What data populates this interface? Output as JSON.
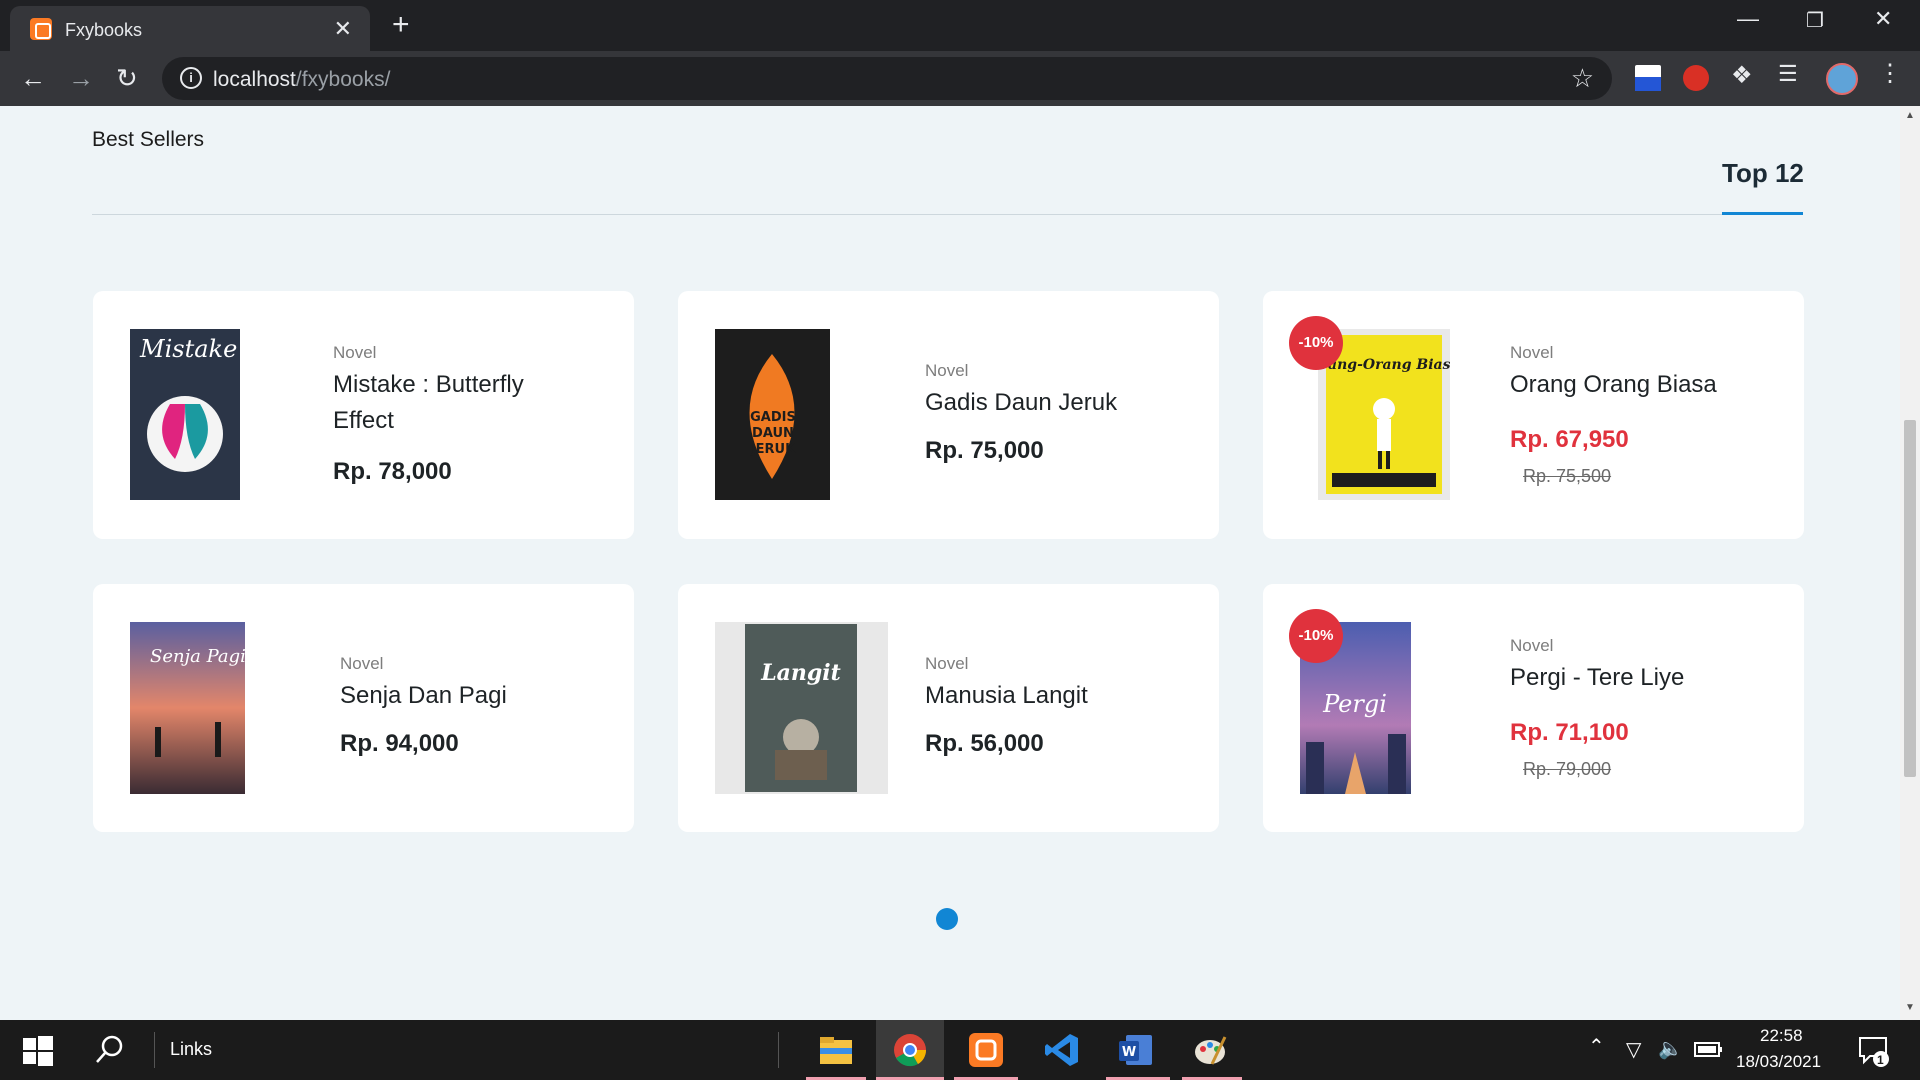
{
  "browser": {
    "tab_title": "Fxybooks",
    "tab_close": "✕",
    "new_tab": "+",
    "url_host": "localhost",
    "url_path": "/fxybooks/"
  },
  "page": {
    "section_label": "Best Sellers",
    "tab_label": "Top 12",
    "accent_color": "#1186d4",
    "sale_color": "#e0323d"
  },
  "products": [
    {
      "category": "Novel",
      "title": "Mistake : Butterfly Effect",
      "price": "Rp. 78,000",
      "discount": "",
      "old_price": ""
    },
    {
      "category": "Novel",
      "title": "Gadis Daun Jeruk",
      "price": "Rp. 75,000",
      "discount": "",
      "old_price": ""
    },
    {
      "category": "Novel",
      "title": "Orang Orang Biasa",
      "price": "Rp. 67,950",
      "discount": "-10%",
      "old_price": "Rp. 75,500"
    },
    {
      "category": "Novel",
      "title": "Senja Dan Pagi",
      "price": "Rp. 94,000",
      "discount": "",
      "old_price": ""
    },
    {
      "category": "Novel",
      "title": "Manusia Langit",
      "price": "Rp. 56,000",
      "discount": "",
      "old_price": ""
    },
    {
      "category": "Novel",
      "title": "Pergi - Tere Liye",
      "price": "Rp. 71,100",
      "discount": "-10%",
      "old_price": "Rp. 79,000"
    }
  ],
  "covers": [
    {
      "label": "Mistake",
      "bg": "#2b3547"
    },
    {
      "label": "'GADIS' 'DAUN' 'JERUK'",
      "bg": "#1d1d1d"
    },
    {
      "label": "Orang-Orang Biasa",
      "bg": "#f2e21d"
    },
    {
      "label": "Senja Pagi",
      "bg": "#3a2b33"
    },
    {
      "label": "Langit",
      "bg": "#4f5b59"
    },
    {
      "label": "Pergi",
      "bg": "#3b4e8f"
    }
  ],
  "taskbar": {
    "search_label": "Links",
    "time": "22:58",
    "date": "18/03/2021",
    "notification_count": "1"
  }
}
